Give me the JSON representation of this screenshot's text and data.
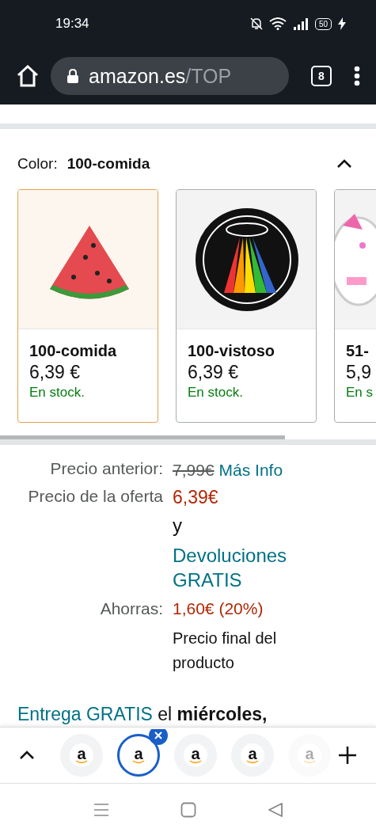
{
  "status_bar": {
    "time": "19:34",
    "battery": "50"
  },
  "browser": {
    "url_host": "amazon.es",
    "url_path": "/TOP",
    "tab_count": "8"
  },
  "color_selector": {
    "label": "Color:",
    "value": "100-comida",
    "expanded": true,
    "swatches": [
      {
        "name": "100-comida",
        "price": "6,39 €",
        "stock": "En stock.",
        "selected": true
      },
      {
        "name": "100-vistoso",
        "price": "6,39 €",
        "stock": "En stock.",
        "selected": false
      },
      {
        "name": "51-",
        "price": "5,9",
        "stock": "En s",
        "selected": false
      }
    ]
  },
  "pricing": {
    "rows": [
      {
        "label": "Precio anterior:",
        "kind": "was",
        "value": "7,99€",
        "link": "Más Info"
      },
      {
        "label": "Precio de la oferta",
        "kind": "offer",
        "value": "6,39€",
        "note": "y",
        "link": "Devoluciones GRATIS"
      },
      {
        "label": "Ahorras:",
        "kind": "saving",
        "value": "1,60€ (20%)",
        "note": "Precio final del producto"
      }
    ]
  },
  "delivery": {
    "link": "Entrega GRATIS",
    "text": "el **miércoles,**"
  },
  "tab_strip": {
    "tabs": [
      {
        "favicon": "a",
        "selected": false,
        "faded": false
      },
      {
        "favicon": "a",
        "selected": true,
        "faded": false
      },
      {
        "favicon": "a",
        "selected": false,
        "faded": false
      },
      {
        "favicon": "a",
        "selected": false,
        "faded": false
      },
      {
        "favicon": "a",
        "selected": false,
        "faded": true
      }
    ]
  }
}
